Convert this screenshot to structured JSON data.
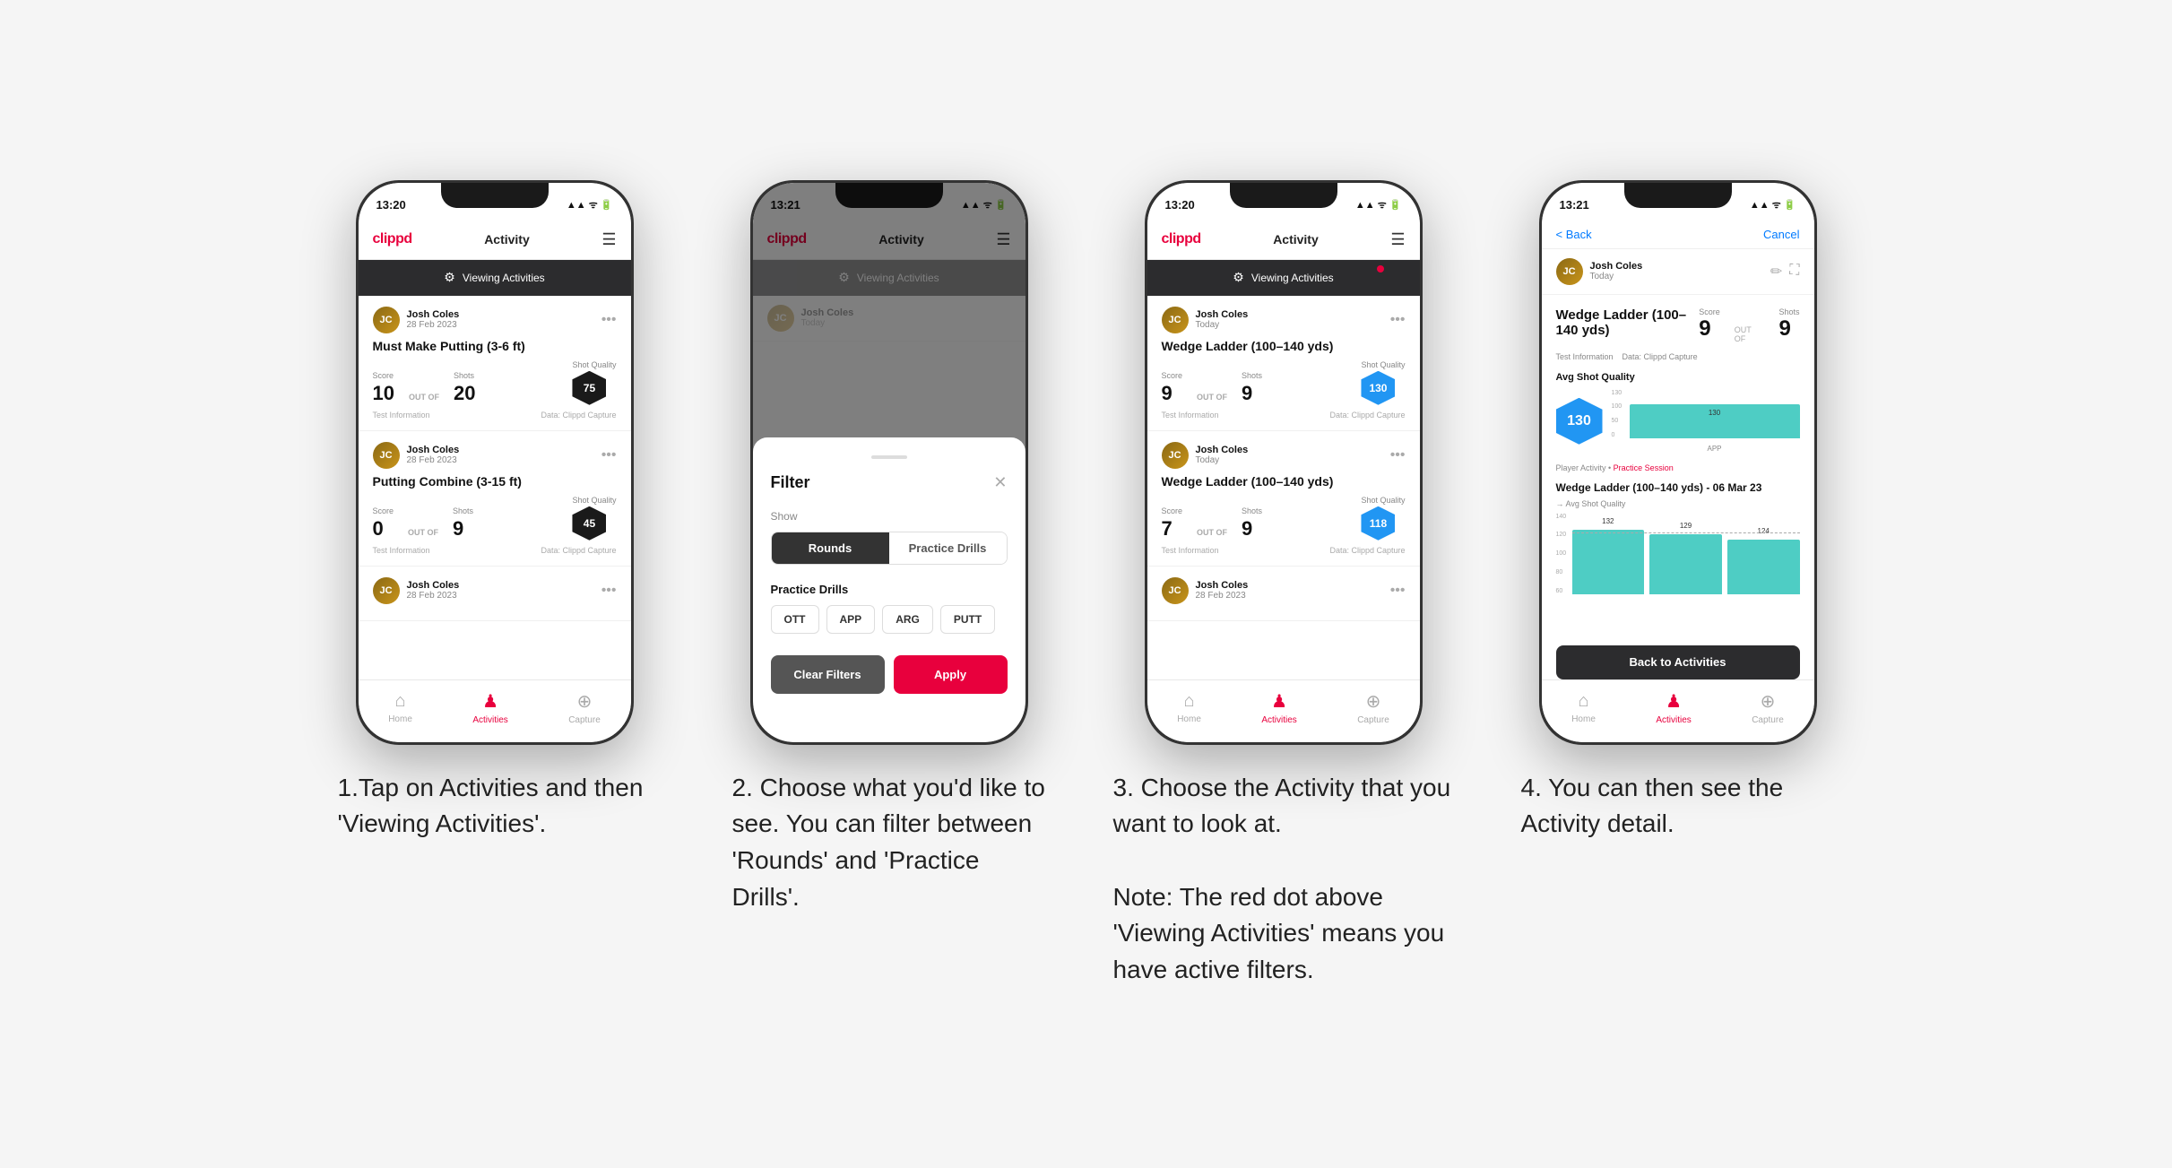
{
  "phones": [
    {
      "id": "phone1",
      "time": "13:20",
      "nav_title": "Activity",
      "filter_banner": "Viewing Activities",
      "has_red_dot": false,
      "cards": [
        {
          "name": "Josh Coles",
          "date": "28 Feb 2023",
          "title": "Must Make Putting (3-6 ft)",
          "score_label": "Score",
          "shots_label": "Shots",
          "sq_label": "Shot Quality",
          "score": "10",
          "shots": "20",
          "sq": "75",
          "sq_blue": false,
          "info": "Test Information",
          "data_source": "Data: Clippd Capture"
        },
        {
          "name": "Josh Coles",
          "date": "28 Feb 2023",
          "title": "Putting Combine (3-15 ft)",
          "score_label": "Score",
          "shots_label": "Shots",
          "sq_label": "Shot Quality",
          "score": "0",
          "shots": "9",
          "sq": "45",
          "sq_blue": false,
          "info": "Test Information",
          "data_source": "Data: Clippd Capture"
        },
        {
          "name": "Josh Coles",
          "date": "28 Feb 2023",
          "title": "",
          "score_label": "",
          "shots_label": "",
          "sq_label": "",
          "score": "",
          "shots": "",
          "sq": "",
          "sq_blue": false,
          "info": "",
          "data_source": ""
        }
      ],
      "caption": "1.Tap on Activities and then 'Viewing Activities'."
    },
    {
      "id": "phone2",
      "time": "13:21",
      "nav_title": "Activity",
      "filter_banner": "Viewing Activities",
      "has_red_dot": false,
      "filter": {
        "title": "Filter",
        "show_label": "Show",
        "tabs": [
          "Rounds",
          "Practice Drills"
        ],
        "active_tab": 0,
        "drills_label": "Practice Drills",
        "drill_tags": [
          "OTT",
          "APP",
          "ARG",
          "PUTT"
        ],
        "clear_label": "Clear Filters",
        "apply_label": "Apply"
      },
      "caption": "2. Choose what you'd like to see. You can filter between 'Rounds' and 'Practice Drills'."
    },
    {
      "id": "phone3",
      "time": "13:20",
      "nav_title": "Activity",
      "filter_banner": "Viewing Activities",
      "has_red_dot": true,
      "cards": [
        {
          "name": "Josh Coles",
          "date": "Today",
          "title": "Wedge Ladder (100–140 yds)",
          "score_label": "Score",
          "shots_label": "Shots",
          "sq_label": "Shot Quality",
          "score": "9",
          "shots": "9",
          "sq": "130",
          "sq_blue": true,
          "info": "Test Information",
          "data_source": "Data: Clippd Capture"
        },
        {
          "name": "Josh Coles",
          "date": "Today",
          "title": "Wedge Ladder (100–140 yds)",
          "score_label": "Score",
          "shots_label": "Shots",
          "sq_label": "Shot Quality",
          "score": "7",
          "shots": "9",
          "sq": "118",
          "sq_blue": true,
          "info": "Test Information",
          "data_source": "Data: Clippd Capture"
        },
        {
          "name": "Josh Coles",
          "date": "28 Feb 2023",
          "title": "",
          "score_label": "",
          "shots_label": "",
          "sq_label": "",
          "score": "",
          "shots": "",
          "sq": "",
          "sq_blue": false,
          "info": "",
          "data_source": ""
        }
      ],
      "caption": "3. Choose the Activity that you want to look at.\n\nNote: The red dot above 'Viewing Activities' means you have active filters."
    },
    {
      "id": "phone4",
      "time": "13:21",
      "back_label": "< Back",
      "cancel_label": "Cancel",
      "user_name": "Josh Coles",
      "user_date": "Today",
      "detail_title": "Wedge Ladder (100–140 yds)",
      "score_label": "Score",
      "shots_label": "Shots",
      "score_value": "9",
      "out_of": "OUT OF",
      "shots_value": "9",
      "info_text": "Test Information",
      "data_text": "Data: Clippd Capture",
      "avg_sq_label": "Avg Shot Quality",
      "sq_value": "130",
      "chart_y_labels": [
        "130",
        "100",
        "50",
        "0"
      ],
      "chart_x_label": "APP",
      "practice_label": "Player Activity • Practice Session",
      "wedge_section": "Wedge Ladder (100–140 yds) - 06 Mar 23",
      "wedge_avg_label": "→ Avg Shot Quality",
      "wedge_bars": [
        {
          "label": "",
          "value": 132,
          "color": "#4ecdc4"
        },
        {
          "label": "",
          "value": 129,
          "color": "#4ecdc4"
        },
        {
          "label": "",
          "value": 124,
          "color": "#4ecdc4"
        }
      ],
      "back_activities_label": "Back to Activities",
      "caption": "4. You can then see the Activity detail."
    }
  ]
}
